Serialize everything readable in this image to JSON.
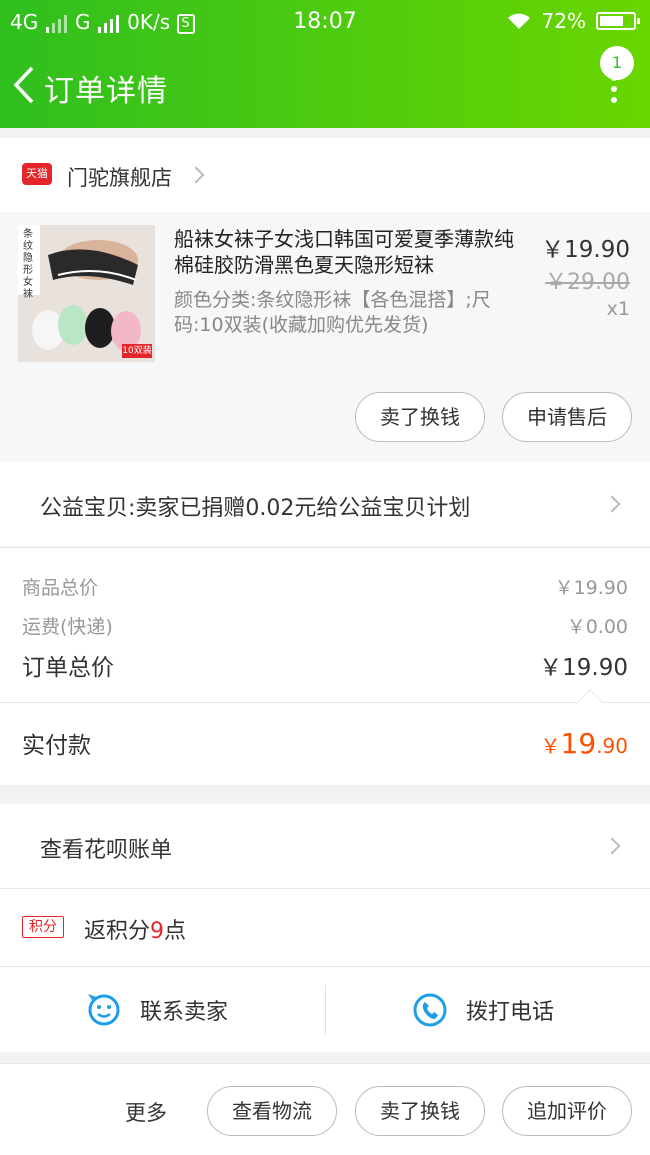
{
  "status_bar": {
    "network_left": "4G",
    "network_mid": "G",
    "speed": "0K/s",
    "sim_icon_label": "S",
    "time": "18:07",
    "battery": "72%",
    "battery_level": 0.72
  },
  "nav": {
    "title": "订单详情",
    "badge_count": "1"
  },
  "store": {
    "badge": "天猫",
    "name": "门驼旗舰店"
  },
  "product": {
    "image_text": "条纹隐形女袜",
    "image_tag": "10双装",
    "title": "船袜女袜子女浅口韩国可爱夏季薄款纯棉硅胶防滑黑色夏天隐形短袜",
    "sku": "颜色分类:条纹隐形袜【各色混搭】;尺码:10双装(收藏加购优先发货)",
    "price": "￥19.90",
    "original_price": "￥29.00",
    "quantity": "x1",
    "buttons": [
      "卖了换钱",
      "申请售后"
    ]
  },
  "charity": {
    "text": "公益宝贝:卖家已捐赠0.02元给公益宝贝计划"
  },
  "summary": {
    "goods_label": "商品总价",
    "goods_value": "￥19.90",
    "shipping_label": "运费(快递)",
    "shipping_value": "￥0.00",
    "total_label": "订单总价",
    "total_value": "￥19.90",
    "paid_label": "实付款",
    "paid_symbol": "￥",
    "paid_int": "19",
    "paid_dec": ".90"
  },
  "huabei": {
    "text": "查看花呗账单"
  },
  "points": {
    "tag": "积分",
    "prefix": "返积分",
    "num": "9",
    "suffix": "点"
  },
  "contact": {
    "seller": "联系卖家",
    "phone": "拨打电话"
  },
  "footer": {
    "more": "更多",
    "buttons": [
      "查看物流",
      "卖了换钱",
      "追加评价"
    ]
  },
  "colors": {
    "brand_green": "#2fbf1f",
    "price_orange": "#ff5000",
    "tmall_red": "#e4262b",
    "contact_blue": "#1d9ee8"
  }
}
